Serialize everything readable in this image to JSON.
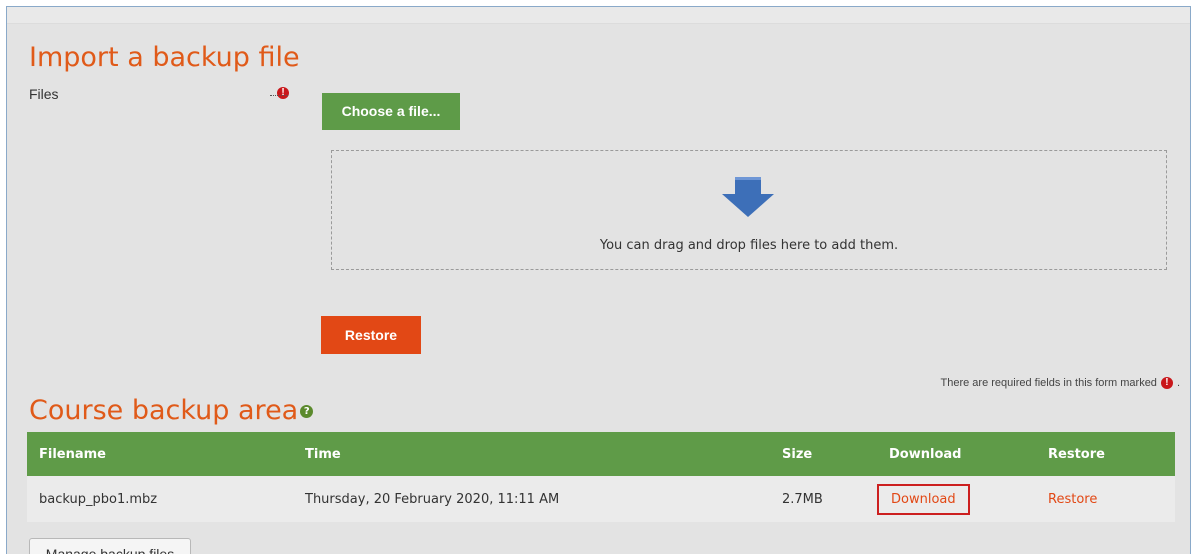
{
  "import_section": {
    "title": "Import a backup file",
    "files_label": "Files",
    "choose_button": "Choose a file...",
    "drop_text": "You can drag and drop files here to add them.",
    "restore_button": "Restore"
  },
  "required_note": {
    "text": "There are required fields in this form marked",
    "suffix": "."
  },
  "backup_area": {
    "title": "Course backup area",
    "columns": [
      "Filename",
      "Time",
      "Size",
      "Download",
      "Restore"
    ],
    "rows": [
      {
        "filename": "backup_pbo1.mbz",
        "time": "Thursday, 20 February 2020, 11:11 AM",
        "size": "2.7MB",
        "download": "Download",
        "restore": "Restore"
      }
    ],
    "manage_button": "Manage backup files"
  },
  "icons": {
    "required": "exclamation-circle-icon",
    "help": "question-circle-icon",
    "drop": "arrow-down-icon"
  },
  "colors": {
    "accent_orange": "#e05a19",
    "green": "#5f9b48",
    "required_red": "#c9171b",
    "highlight_red": "#cc1f1f"
  }
}
